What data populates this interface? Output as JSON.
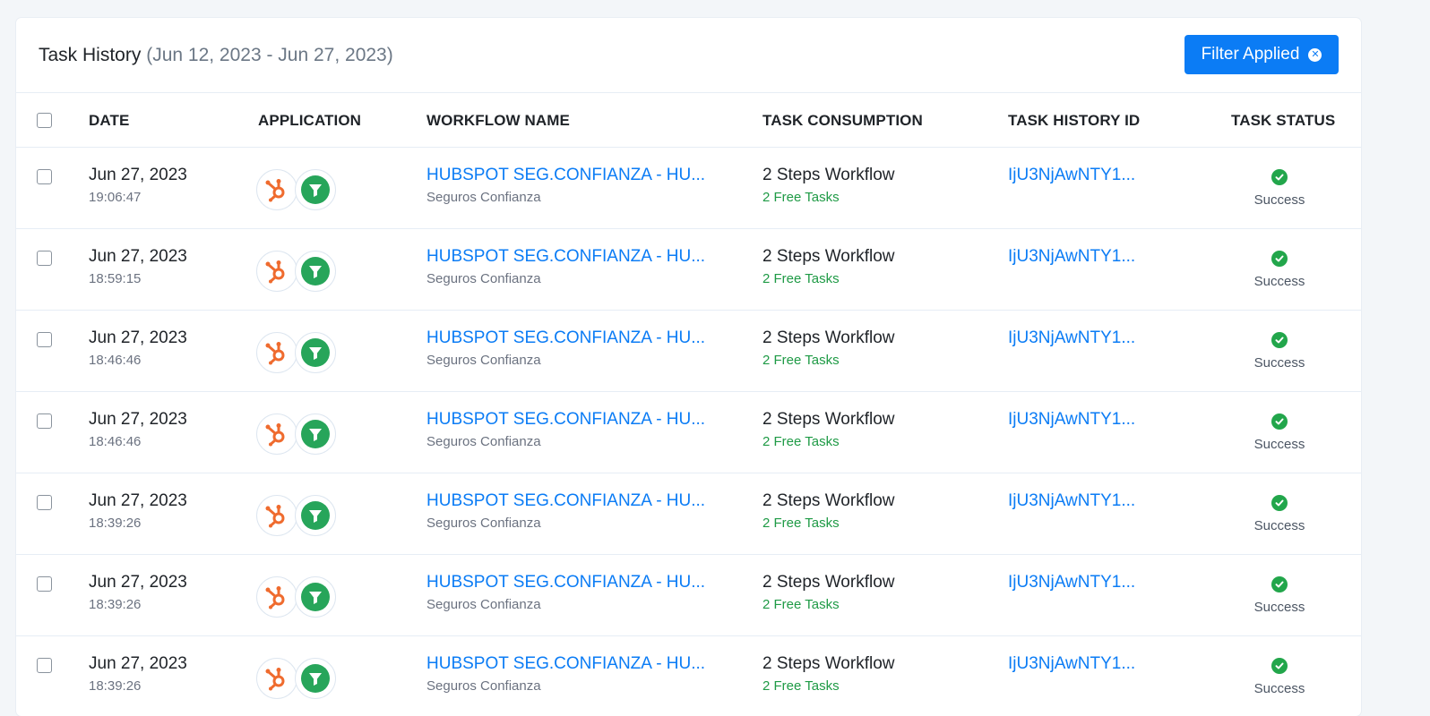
{
  "header": {
    "title": "Task History",
    "date_range": "(Jun 12, 2023 - Jun 27, 2023)",
    "filter_label": "Filter Applied"
  },
  "columns": {
    "date": "DATE",
    "application": "APPLICATION",
    "workflow_name": "WORKFLOW NAME",
    "task_consumption": "TASK CONSUMPTION",
    "task_history_id": "TASK HISTORY ID",
    "task_status": "TASK STATUS"
  },
  "rows": [
    {
      "date": "Jun 27, 2023",
      "time": "19:06:47",
      "workflow": "HUBSPOT SEG.CONFIANZA - HU...",
      "org": "Seguros Confianza",
      "consumption": "2 Steps Workflow",
      "free": "2 Free Tasks",
      "history_id": "IjU3NjAwNTY1...",
      "status": "Success"
    },
    {
      "date": "Jun 27, 2023",
      "time": "18:59:15",
      "workflow": "HUBSPOT SEG.CONFIANZA - HU...",
      "org": "Seguros Confianza",
      "consumption": "2 Steps Workflow",
      "free": "2 Free Tasks",
      "history_id": "IjU3NjAwNTY1...",
      "status": "Success"
    },
    {
      "date": "Jun 27, 2023",
      "time": "18:46:46",
      "workflow": "HUBSPOT SEG.CONFIANZA - HU...",
      "org": "Seguros Confianza",
      "consumption": "2 Steps Workflow",
      "free": "2 Free Tasks",
      "history_id": "IjU3NjAwNTY1...",
      "status": "Success"
    },
    {
      "date": "Jun 27, 2023",
      "time": "18:46:46",
      "workflow": "HUBSPOT SEG.CONFIANZA - HU...",
      "org": "Seguros Confianza",
      "consumption": "2 Steps Workflow",
      "free": "2 Free Tasks",
      "history_id": "IjU3NjAwNTY1...",
      "status": "Success"
    },
    {
      "date": "Jun 27, 2023",
      "time": "18:39:26",
      "workflow": "HUBSPOT SEG.CONFIANZA - HU...",
      "org": "Seguros Confianza",
      "consumption": "2 Steps Workflow",
      "free": "2 Free Tasks",
      "history_id": "IjU3NjAwNTY1...",
      "status": "Success"
    },
    {
      "date": "Jun 27, 2023",
      "time": "18:39:26",
      "workflow": "HUBSPOT SEG.CONFIANZA - HU...",
      "org": "Seguros Confianza",
      "consumption": "2 Steps Workflow",
      "free": "2 Free Tasks",
      "history_id": "IjU3NjAwNTY1...",
      "status": "Success"
    },
    {
      "date": "Jun 27, 2023",
      "time": "18:39:26",
      "workflow": "HUBSPOT SEG.CONFIANZA - HU...",
      "org": "Seguros Confianza",
      "consumption": "2 Steps Workflow",
      "free": "2 Free Tasks",
      "history_id": "IjU3NjAwNTY1...",
      "status": "Success"
    }
  ],
  "icons": {
    "app_1": "hubspot-icon",
    "app_2": "filter-funnel-icon",
    "status": "check-circle-icon",
    "filter_clear": "close-circle-icon"
  },
  "colors": {
    "accent": "#0b7cf5",
    "success": "#22a64b",
    "hubspot": "#ef6b2e",
    "filter_app": "#27a55a"
  }
}
